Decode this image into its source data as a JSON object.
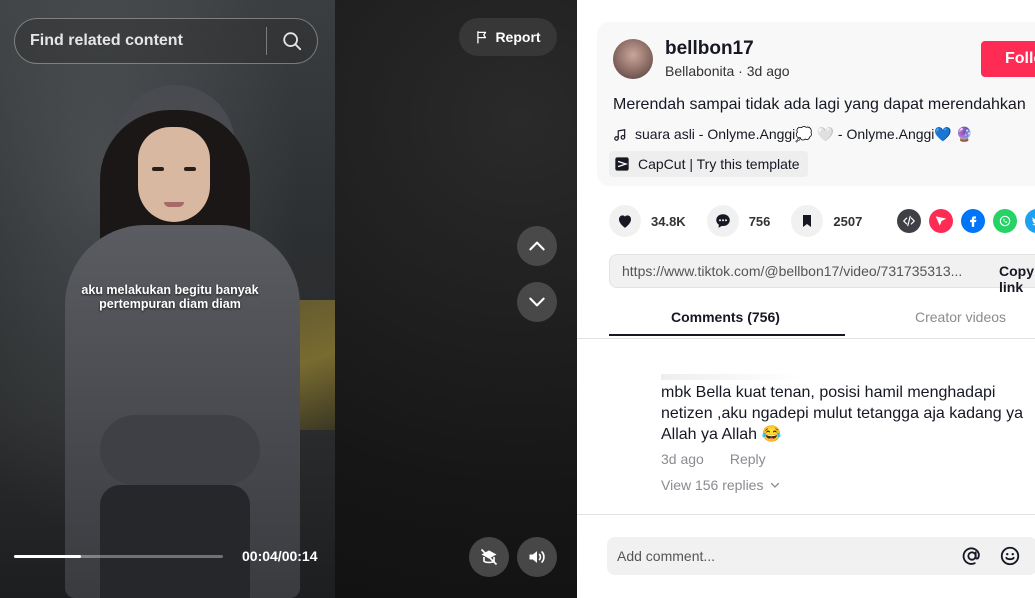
{
  "video": {
    "caption_line1": "aku melakukan begitu banyak",
    "caption_line2": "pertempuran diam diam",
    "progress": 0.32,
    "time": "00:04/00:14"
  },
  "search": {
    "placeholder": "Find related content",
    "icon": "search-icon"
  },
  "report": {
    "label": "Report",
    "icon": "flag-icon"
  },
  "author": {
    "username": "bellbon17",
    "nickname": "Bellabonita",
    "separator": " · ",
    "posted": "3d ago",
    "follow_label": "Follow"
  },
  "post": {
    "description": "Merendah sampai tidak ada lagi yang dapat merendahkan",
    "music": "suara asli - Onlyme.Anggi💭 🤍 - Onlyme.Anggi💙 🔮",
    "capcut": "CapCut | Try this template"
  },
  "actions": {
    "likes": "34.8K",
    "comments": "756",
    "saves": "2507"
  },
  "share_colors": {
    "embed": "#3f3f46",
    "direct": "#fe2c55",
    "facebook": "#0075fa",
    "whatsapp": "#25d366",
    "twitter": "#1da1f2"
  },
  "link": {
    "url": "https://www.tiktok.com/@bellbon17/video/731735313...",
    "copy_label": "Copy link"
  },
  "tabs": {
    "comments": "Comments (756)",
    "creator": "Creator videos"
  },
  "comment": {
    "text": "mbk Bella kuat tenan, posisi hamil menghadapi netizen ,aku ngadepi mulut tetangga aja kadang ya Allah ya Allah 😂",
    "posted": "3d ago",
    "reply_label": "Reply",
    "view_replies": "View 156 replies"
  },
  "add_comment": {
    "placeholder": "Add comment..."
  }
}
